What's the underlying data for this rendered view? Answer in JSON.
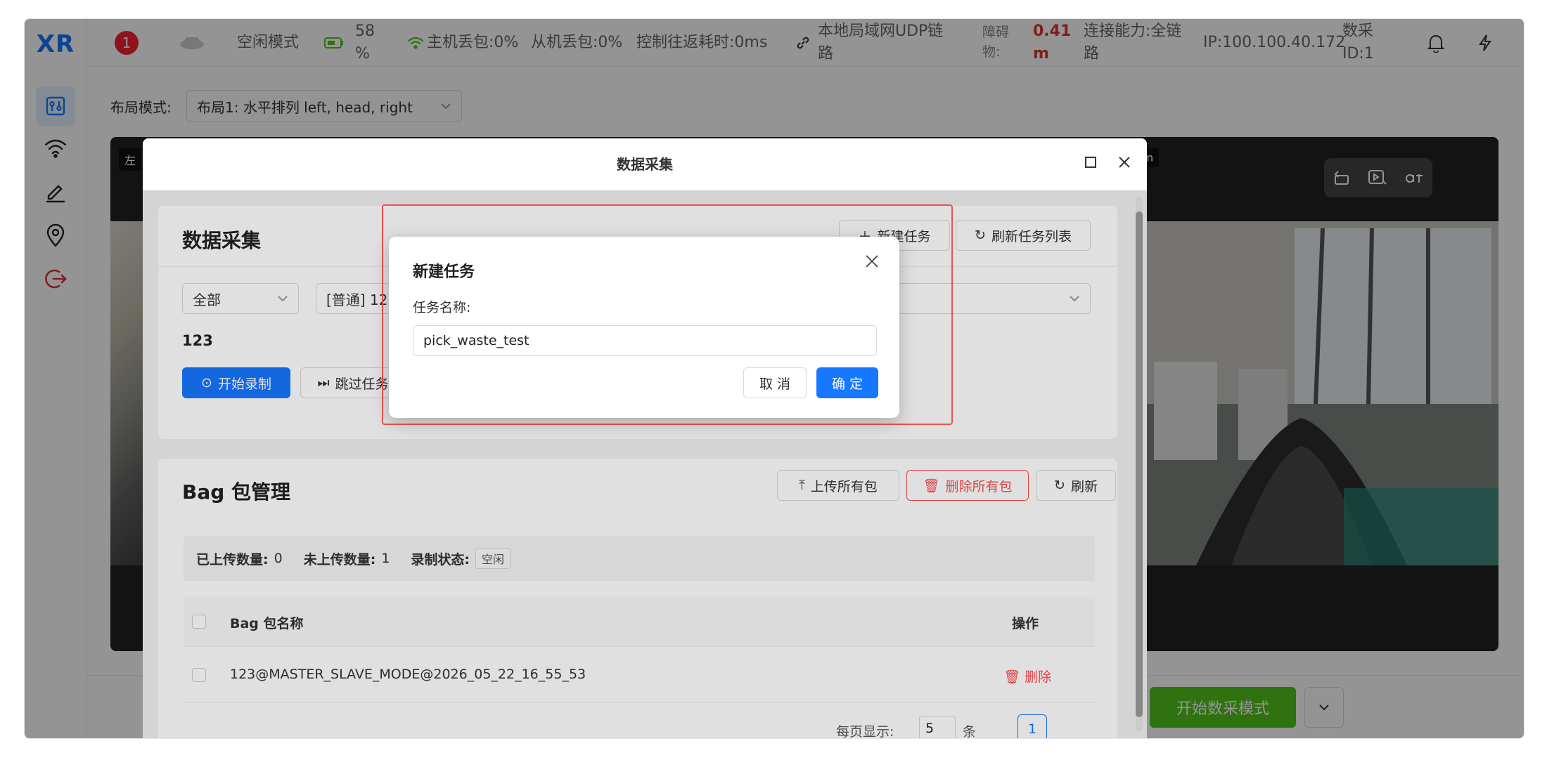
{
  "app": {
    "logo": "XR"
  },
  "topbar": {
    "alert_count": "1",
    "mode": "空闲模式",
    "battery": "58 %",
    "master_loss": "主机丢包:0%",
    "slave_loss": "从机丢包:0%",
    "rtt": "控制往返耗时:0ms",
    "link": "本地局域网UDP链路",
    "obstacle_label": "障碍物:",
    "obstacle_value": "0.41 m",
    "capability": "连接能力:全链路",
    "ip": "IP:100.100.40.172",
    "collect_id": "数采ID:1"
  },
  "layout": {
    "label": "布局模式:",
    "value": "布局1: 水平排列 left, head, right"
  },
  "video": {
    "left_tag": "左",
    "right_tag": "mm"
  },
  "bottom": {
    "start_label": "开始数采模式"
  },
  "modal": {
    "title": "数据采集",
    "collect_card": {
      "title": "数据采集",
      "new_task": "新建任务",
      "refresh_tasks": "刷新任务列表",
      "filter_value": "全部",
      "task_select": "[普通] 123",
      "task_name": "123",
      "start_record": "开始录制",
      "skip_task": "跳过任务"
    },
    "bag_card": {
      "title": "Bag 包管理",
      "upload_all": "上传所有包",
      "delete_all": "删除所有包",
      "refresh": "刷新",
      "uploaded_label": "已上传数量:",
      "uploaded_value": "0",
      "not_uploaded_label": "未上传数量:",
      "not_uploaded_value": "1",
      "record_state_label": "录制状态:",
      "record_state_value": "空闲",
      "col_name": "Bag 包名称",
      "col_action": "操作",
      "rows": [
        {
          "name": "123@MASTER_SLAVE_MODE@2026_05_22_16_55_53",
          "action": "删除"
        }
      ],
      "page_size_label": "每页显示:",
      "page_size_value": "5",
      "page_size_unit": "条",
      "current_page": "1"
    }
  },
  "dialog": {
    "title": "新建任务",
    "field_label": "任务名称:",
    "field_value": "pick_waste_test",
    "cancel": "取 消",
    "confirm": "确 定"
  }
}
